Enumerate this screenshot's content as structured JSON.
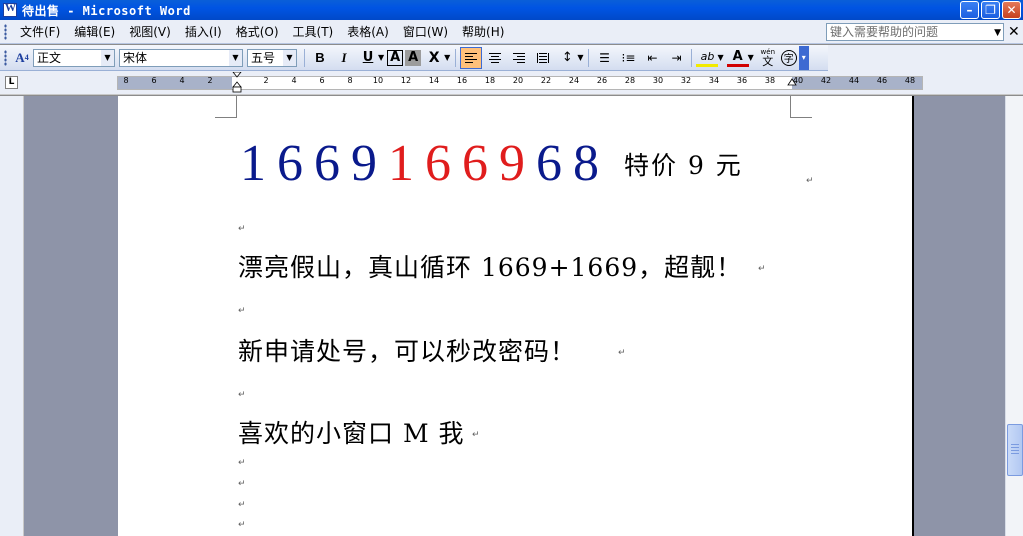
{
  "window": {
    "title": "待出售 - Microsoft Word"
  },
  "menu": {
    "items": [
      "文件(F)",
      "编辑(E)",
      "视图(V)",
      "插入(I)",
      "格式(O)",
      "工具(T)",
      "表格(A)",
      "窗口(W)",
      "帮助(H)"
    ],
    "help_placeholder": "键入需要帮助的问题"
  },
  "toolbar": {
    "style": "正文",
    "font": "宋体",
    "size": "五号",
    "bold": "B",
    "italic": "I",
    "underline": "U",
    "char_border": "A",
    "char_shading": "A",
    "scale": "X",
    "font_color": "A",
    "phonetic": "wén",
    "phonetic_char": "文",
    "enclose": "字",
    "alignment": "left"
  },
  "ruler": {
    "tab_selector": "L",
    "labels": [
      "8",
      "6",
      "4",
      "2",
      "2",
      "4",
      "6",
      "8",
      "10",
      "12",
      "14",
      "16",
      "18",
      "20",
      "22",
      "24",
      "26",
      "28",
      "30",
      "32",
      "34",
      "36",
      "38",
      "40",
      "42",
      "44",
      "46",
      "48"
    ]
  },
  "document": {
    "headline_digits_blue_1": "1669",
    "headline_digits_red": "1669",
    "headline_digits_blue_2": "68",
    "headline_price": "特价 9 元",
    "para1": "漂亮假山，真山循环 1669+1669，超靓！",
    "para2": "新申请处号，可以秒改密码！",
    "para3": "喜欢的小窗口 M 我",
    "mark": "↵"
  }
}
